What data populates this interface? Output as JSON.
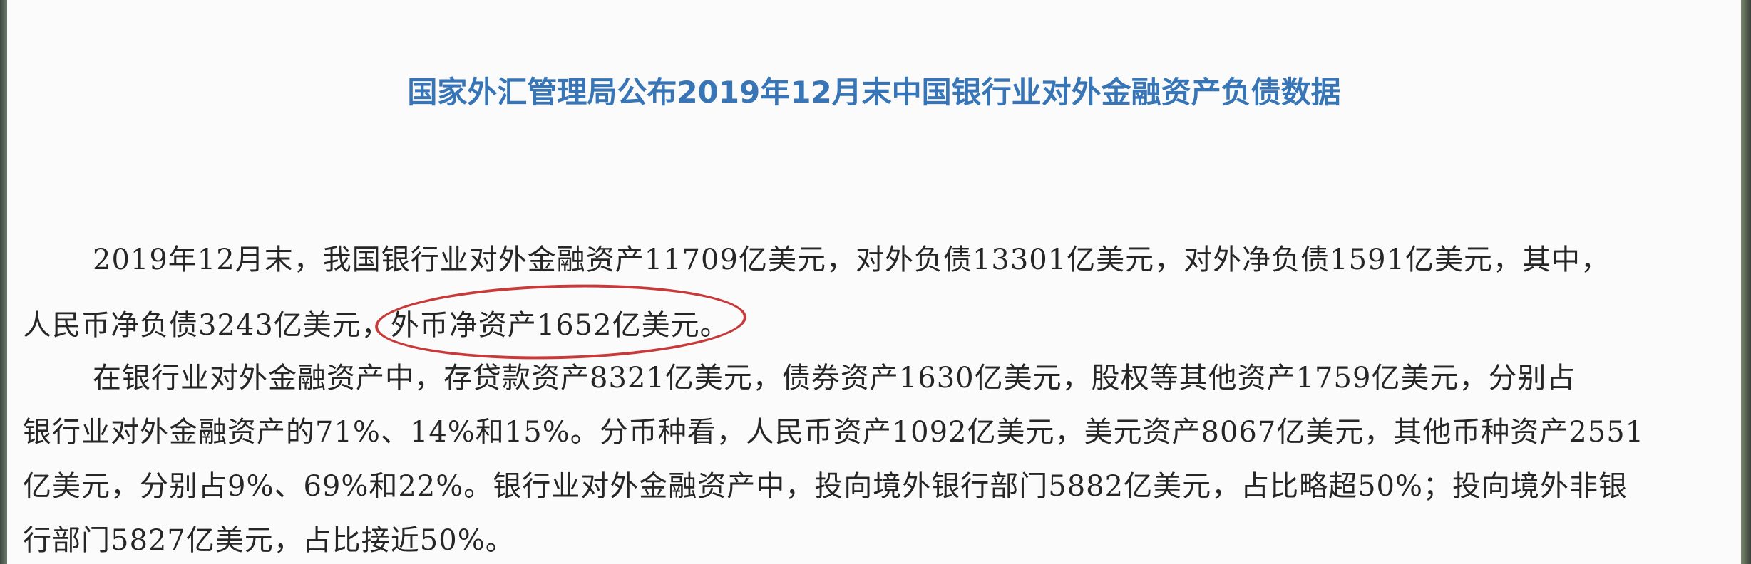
{
  "document": {
    "title": "国家外汇管理局公布2019年12月末中国银行业对外金融资产负债数据",
    "paragraph1": {
      "line1": "2019年12月末，我国银行业对外金融资产11709亿美元，对外负债13301亿美元，对外净负债1591亿美元，其中，",
      "line2_before": "人民币净负债3243亿美元，",
      "line2_circled": "外币净资产1652亿美元。"
    },
    "paragraph2": {
      "line1": "在银行业对外金融资产中，存贷款资产8321亿美元，债券资产1630亿美元，股权等其他资产1759亿美元，分别占",
      "line2": "银行业对外金融资产的71%、14%和15%。分币种看，人民币资产1092亿美元，美元资产8067亿美元，其他币种资产2551",
      "line3": "亿美元，分别占9%、69%和22%。银行业对外金融资产中，投向境外银行部门5882亿美元，占比略超50%；投向境外非银",
      "line4": "行部门5827亿美元，占比接近50%。"
    }
  },
  "colors": {
    "title": "#3775b6",
    "text": "#262626",
    "annotation_circle": "#c8393a",
    "paper": "#fbfbfb"
  }
}
